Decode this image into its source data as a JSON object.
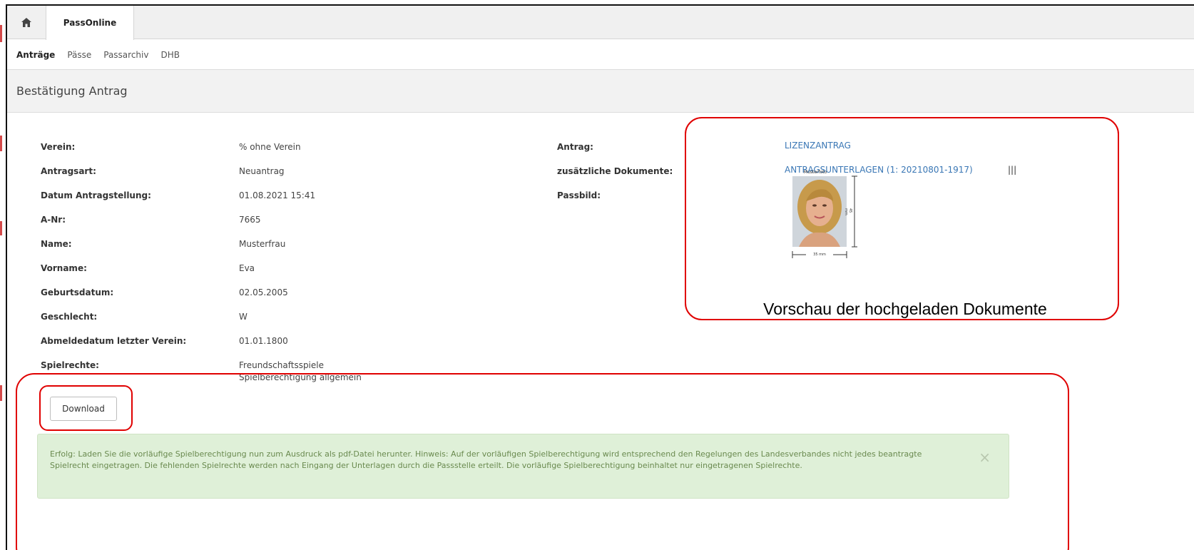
{
  "tabs": {
    "home_icon": "home-icon",
    "active_label": "PassOnline"
  },
  "subnav": [
    "Anträge",
    "Pässe",
    "Passarchiv",
    "DHB"
  ],
  "page_title": "Bestätigung Antrag",
  "left_fields": [
    {
      "label": "Verein:",
      "value": "% ohne Verein"
    },
    {
      "label": "Antragsart:",
      "value": "Neuantrag"
    },
    {
      "label": "Datum Antragstellung:",
      "value": "01.08.2021 15:41"
    },
    {
      "label": "A-Nr:",
      "value": "7665"
    },
    {
      "label": "Name:",
      "value": "Musterfrau"
    },
    {
      "label": "Vorname:",
      "value": "Eva"
    },
    {
      "label": "Geburtsdatum:",
      "value": "02.05.2005"
    },
    {
      "label": "Geschlecht:",
      "value": "W"
    },
    {
      "label": "Abmeldedatum letzter Verein:",
      "value": "01.01.1800"
    },
    {
      "label": "Spielrechte:",
      "value": "Freundschaftsspiele",
      "value2": "Spielberechtigung allgemein"
    }
  ],
  "right_fields": {
    "antrag_label": "Antrag:",
    "antrag_link": "LIZENZANTRAG",
    "docs_label": "zusätzliche Dokumente:",
    "docs_link": "ANTRAGSUNTERLAGEN (1: 20210801-1917)",
    "docs_separator": "|||",
    "passbild_label": "Passbild:"
  },
  "passphoto": {
    "caption": "Musterfoto",
    "height_label": "45 mm",
    "width_label": "35 mm"
  },
  "download_label": "Download",
  "alert": {
    "text": "Erfolg: Laden Sie die vorläufige Spielberechtigung nun zum Ausdruck als pdf-Datei herunter. Hinweis: Auf der vorläufigen Spielberechtigung wird entsprechend den Regelungen des Landesverbandes nicht jedes beantragte Spielrecht eingetragen. Die fehlenden Spielrechte werden nach Eingang der Unterlagen durch die Passstelle erteilt. Die vorläufige Spielberechtigung beinhaltet nur eingetragenen Spielrechte.",
    "close": "×"
  },
  "annotation_text": "Vorschau der hochgeladen Dokumente",
  "colors": {
    "link": "#3a77b5",
    "annotation_red": "#e00000",
    "alert_bg": "#dff0d8"
  }
}
